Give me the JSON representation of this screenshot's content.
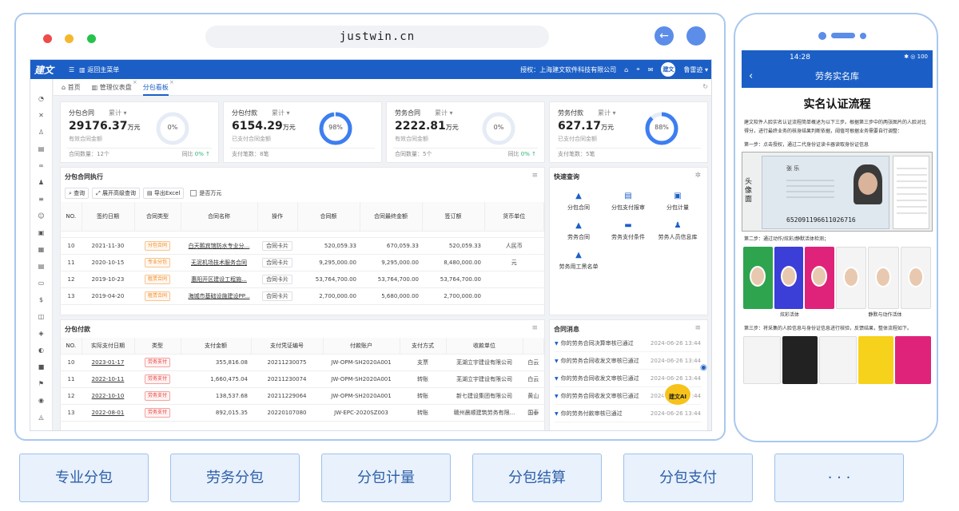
{
  "browser": {
    "url": "justwin.cn",
    "dot_colors": [
      "#ee4b4b",
      "#f5b82c",
      "#27c24c"
    ]
  },
  "app": {
    "logo": "建文",
    "back_main": "返回主菜单",
    "license": "授权：上海建文软件科技有限公司",
    "username": "鲁雷迹",
    "avatar_text": "建文",
    "tabs": [
      {
        "label": "首页"
      },
      {
        "label": "管理仪表盘"
      },
      {
        "label": "分包看板"
      }
    ]
  },
  "kpis": [
    {
      "title": "分包合同",
      "sel": "累计",
      "value": "29176.37",
      "unit": "万元",
      "desc": "有效合同金额",
      "foot": "合同数量：12个",
      "foot2_label": "同比",
      "foot2_val": "0% ↑",
      "percent": 0,
      "ring_label": "0%"
    },
    {
      "title": "分包付款",
      "sel": "累计",
      "value": "6154.29",
      "unit": "万元",
      "desc": "已支付合同金额",
      "foot": "支付笔数：8笔",
      "foot2_label": "",
      "foot2_val": "",
      "percent": 98,
      "ring_label": "98%"
    },
    {
      "title": "劳务合同",
      "sel": "累计",
      "value": "2222.81",
      "unit": "万元",
      "desc": "有效合同金额",
      "foot": "合同数量：5个",
      "foot2_label": "同比",
      "foot2_val": "0% ↑",
      "percent": 0,
      "ring_label": "0%"
    },
    {
      "title": "劳务付款",
      "sel": "累计",
      "value": "627.17",
      "unit": "万元",
      "desc": "已支付合同金额",
      "foot": "支付笔数：5笔",
      "foot2_label": "",
      "foot2_val": "",
      "percent": 88,
      "ring_label": "88%"
    }
  ],
  "contracts": {
    "title": "分包合同执行",
    "toolbar": [
      "查询",
      "展开高级查询",
      "导出Excel"
    ],
    "checkbox": "是否万元",
    "headers": [
      "NO.",
      "签约日期",
      "合同类型",
      "合同名称",
      "操作",
      "合同额",
      "合同最终金额",
      "签订额",
      "货币单位"
    ],
    "rows": [
      [
        "10",
        "2021-11-30",
        "分包合同",
        "白天鹅宾馆防水专业分...",
        "合同卡片",
        "520,059.33",
        "670,059.33",
        "520,059.33",
        "人民币"
      ],
      [
        "11",
        "2020-10-15",
        "专业分包",
        "无泥机场技术服务合同",
        "合同卡片",
        "9,295,000.00",
        "9,295,000.00",
        "8,480,000.00",
        "元"
      ],
      [
        "12",
        "2019-10-23",
        "租赁合同",
        "惠阳开区建设工程施...",
        "合同卡片",
        "53,764,700.00",
        "53,764,700.00",
        "53,764,700.00",
        ""
      ],
      [
        "13",
        "2019-04-20",
        "租赁合同",
        "海城市基础设施建设PP...",
        "合同卡片",
        "2,700,000.00",
        "5,680,000.00",
        "2,700,000.00",
        ""
      ]
    ]
  },
  "quick": {
    "title": "快速查询",
    "items": [
      "分包合同",
      "分包支付报审",
      "分包计量",
      "劳务合同",
      "劳务支付条件",
      "劳务人员信息库",
      "劳务用工黑名单"
    ]
  },
  "payments": {
    "title": "分包付款",
    "headers": [
      "NO.",
      "实际支付日期",
      "类型",
      "支付金额",
      "支付凭证编号",
      "付款账户",
      "支付方式",
      "收款单位",
      ""
    ],
    "rows": [
      [
        "10",
        "2023-01-17",
        "劳务支付",
        "355,816.08",
        "20211230075",
        "JW-OPM-SH2020A001",
        "支票",
        "芜湖立宇建设有限公司",
        "白云"
      ],
      [
        "11",
        "2022-10-11",
        "劳务支付",
        "1,660,475.04",
        "20211230074",
        "JW-OPM-SH2020A001",
        "转账",
        "芜湖立宇建设有限公司",
        "白云"
      ],
      [
        "12",
        "2022-10-10",
        "劳务支付",
        "138,537.68",
        "20211229064",
        "JW-OPM-SH2020A001",
        "转账",
        "新七建设集团有限公司",
        "黄山"
      ],
      [
        "13",
        "2022-08-01",
        "劳务支付",
        "892,015.35",
        "20220107080",
        "JW-EPC-2020SZ003",
        "转账",
        "赣州晨顺建筑劳务有限...",
        "国泰"
      ]
    ]
  },
  "messages": {
    "title": "合同消息",
    "items": [
      {
        "text": "你的劳务合同决算审核已通过",
        "time": "2024-06-26 13:44"
      },
      {
        "text": "你的劳务合同收发文审核已通过",
        "time": "2024-06-26 13:44"
      },
      {
        "text": "你的劳务合同收发文审核已通过",
        "time": "2024-06-26 13:44"
      },
      {
        "text": "你的劳务合同收发文审核已通过",
        "time": "2024-06-26 13:44"
      },
      {
        "text": "你的劳务付款审核已通过",
        "time": "2024-06-26 13:44"
      }
    ]
  },
  "ai_button": "建文AI",
  "phone": {
    "time": "14:28",
    "status_icons": "✱ ◎ 100",
    "header": "劳务实名库",
    "title": "实名认证流程",
    "intro": "建文软件人脸实名认证流程简单概述为以下三步。根据第三步中的两张图片的人脸对比得分，进行最终业务的核身结果判断依据，阈值可根据业务需要自行调整：",
    "step1": "第一步：点击授权，通过二代身份证读卡器读取身份证信息",
    "card_label": "头像面",
    "card_name": "张 乐",
    "card_number": "652091196611026716",
    "step2": "第二步：通过动作/炫彩/静默活体检测；",
    "caption1": "炫彩活体",
    "caption2": "静默与动作活体",
    "step3": "第三步：将采集的人脸信息与身份证信息进行核验，反馈结果，整体流程如下。"
  },
  "modules": [
    "专业分包",
    "劳务分包",
    "分包计量",
    "分包结算",
    "分包支付",
    "· · ·"
  ]
}
